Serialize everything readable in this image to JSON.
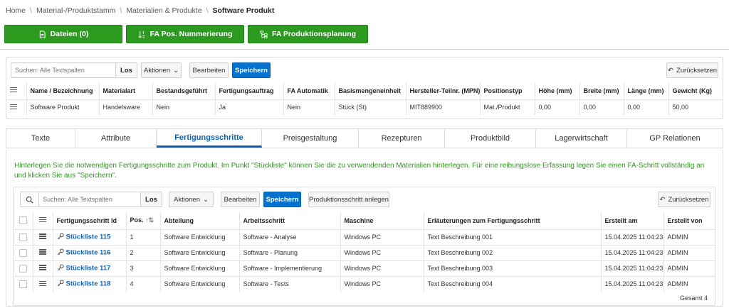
{
  "breadcrumb": [
    "Home",
    "Material-/Produktstamm",
    "Materialien & Produkte",
    "Software Produkt"
  ],
  "actions": {
    "dateien": "Dateien (0)",
    "fa_pos": "FA Pos. Nummerierung",
    "fa_produktion": "FA Produktionsplanung"
  },
  "top_grid": {
    "search_placeholder": "Suchen: Alle Textspalten",
    "go": "Los",
    "aktionen": "Aktionen",
    "bearbeiten": "Bearbeiten",
    "speichern": "Speichern",
    "reset": "Zurücksetzen",
    "columns": [
      "Name / Bezeichnung",
      "Materialart",
      "Bestandsgeführt",
      "Fertigungsauftrag",
      "FA Automatik",
      "Basismengeneinheit",
      "Hersteller-Teilnr. (MPN)",
      "Positionstyp",
      "Höhe (mm)",
      "Breite (mm)",
      "Länge (mm)",
      "Gewicht (Kg)"
    ],
    "row": [
      "Software Produkt",
      "Handelsware",
      "Nein",
      "Ja",
      "Nein",
      "Stück (St)",
      "MIT889900",
      "Mat./Produkt",
      "0,00",
      "0,00",
      "0,00",
      "50,00"
    ]
  },
  "tabs": [
    "Texte",
    "Attribute",
    "Fertigungsschritte",
    "Preisgestaltung",
    "Rezepturen",
    "Produktbild",
    "Lagerwirtschaft",
    "GP Relationen"
  ],
  "active_tab": "Fertigungsschritte",
  "hint": "Hinterlegen Sie die notwendigen Fertigungsschritte zum Produkt. Im Punkt \"Stückliste\" können Sie die zu verwendenden Materialien hinterlegen. Für eine reibungslose Erfassung legen Sie einen FA-Schritt vollständig an und klicken Sie aus \"Speichern\".",
  "steps_grid": {
    "search_placeholder": "Suchen: Alle Textspalten",
    "go": "Los",
    "aktionen": "Aktionen",
    "bearbeiten": "Bearbeiten",
    "speichern": "Speichern",
    "anlegen": "Produktionsschritt anlegen",
    "reset": "Zurücksetzen",
    "columns": [
      "Fertigungsschritt Id",
      "Pos.",
      "Abteilung",
      "Arbeitsschritt",
      "Maschine",
      "Erläuterungen zum Fertigungsschritt",
      "Erstellt am",
      "Erstellt von"
    ],
    "rows": [
      [
        "Stückliste 115",
        "1",
        "Software Entwicklung",
        "Software - Analyse",
        "Windows PC",
        "Text Beschreibung 001",
        "15.04.2025 11:04:23",
        "ADMIN"
      ],
      [
        "Stückliste 116",
        "2",
        "Software Entwicklung",
        "Software - Planung",
        "Windows PC",
        "Text Beschreibung 002",
        "15.04.2025 11:04:23",
        "ADMIN"
      ],
      [
        "Stückliste 117",
        "3",
        "Software Entwicklung",
        "Software - Implementierung",
        "Windows PC",
        "Text Beschreibung 003",
        "15.04.2025 11:04:23",
        "ADMIN"
      ],
      [
        "Stückliste 118",
        "4",
        "Software Entwicklung",
        "Software - Tests",
        "Windows PC",
        "Text Beschreibung 004",
        "15.04.2025 11:04:23",
        "ADMIN"
      ]
    ],
    "total": "Gesamt 4"
  },
  "colors": {
    "green": "#2c9a1f",
    "blue": "#0572ce",
    "link": "#0b62b8",
    "hint": "#2a9a18"
  }
}
